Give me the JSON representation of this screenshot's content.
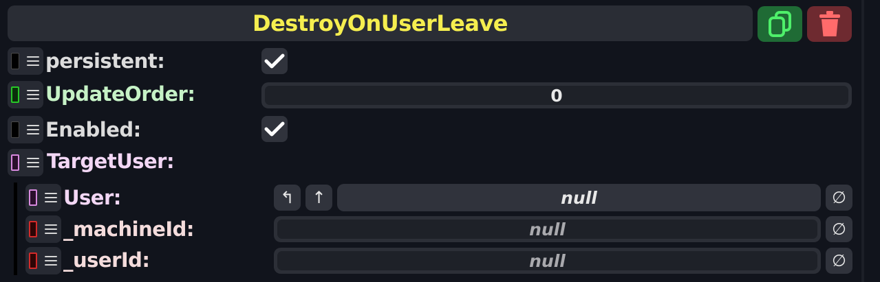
{
  "header": {
    "title": "DestroyOnUserLeave",
    "duplicate_icon": "duplicate-icon",
    "delete_icon": "trash-icon",
    "title_color": "#f5ee4f"
  },
  "fields": {
    "persistent": {
      "label": "persistent:",
      "checked": true,
      "color": "#dcdcdc"
    },
    "update_order": {
      "label": "UpdateOrder:",
      "value": "0",
      "color": "#c6f2c6"
    },
    "enabled": {
      "label": "Enabled:",
      "checked": true,
      "color": "#dcdcdc"
    },
    "target_user": {
      "label": "TargetUser:",
      "color": "#f3d7f5",
      "user": {
        "label": "User:",
        "value": "null",
        "color": "#f3d7f5"
      },
      "machine_id": {
        "label": "_machineId:",
        "value": "null",
        "color": "#f4dcdc"
      },
      "user_id": {
        "label": "_userId:",
        "value": "null",
        "color": "#f4dcdc"
      }
    }
  },
  "buttons": {
    "jump": "↰",
    "up": "↑",
    "clear": "∅"
  }
}
